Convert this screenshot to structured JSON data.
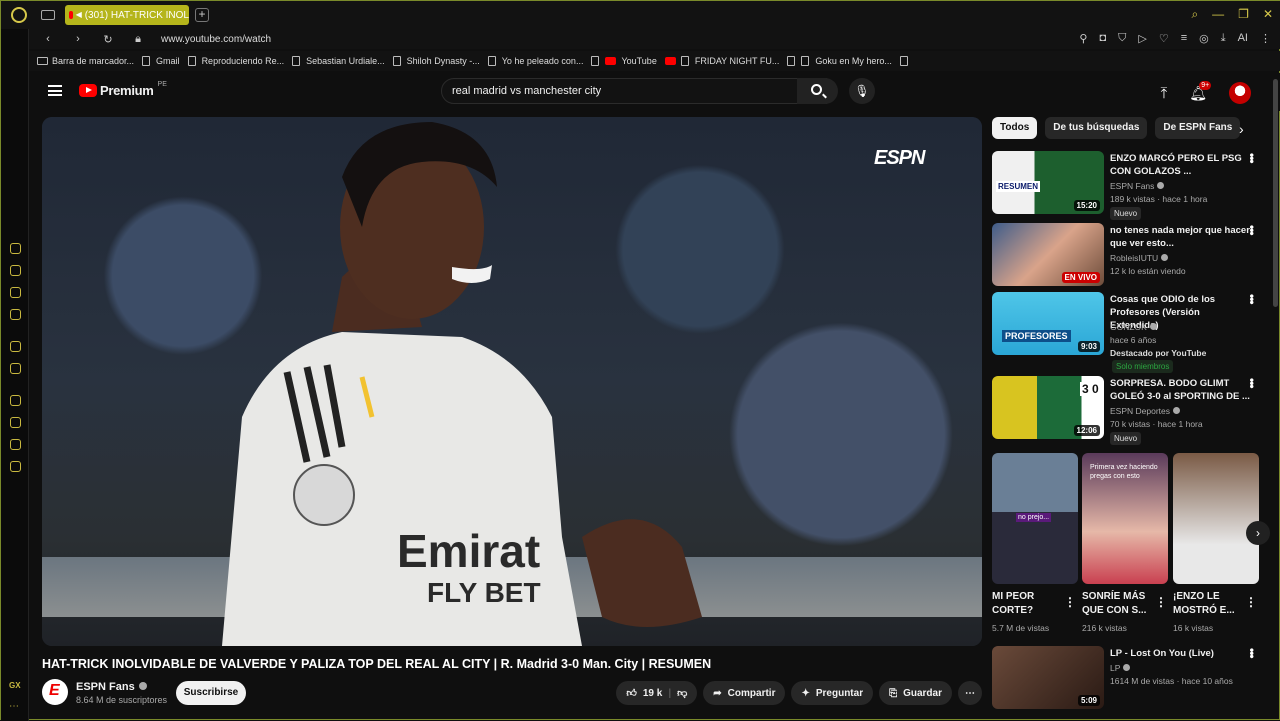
{
  "browser": {
    "tab_title": "(301) HAT-TRICK INOL",
    "url": "www.youtube.com/watch",
    "ai_label": "AI",
    "bookmarks": [
      "Barra de marcador...",
      "Gmail",
      "Reproduciendo Re...",
      "Sebastian Urdiale...",
      "Shiloh Dynasty -...",
      "Yo he peleado con...",
      "YouTube",
      "FRIDAY NIGHT FU...",
      "Goku en My hero..."
    ]
  },
  "header": {
    "brand": "Premium",
    "region": "PE",
    "search_value": "real madrid vs manchester city",
    "bell_badge": "9+"
  },
  "video": {
    "overlay_logo": "ESPN",
    "title": "HAT-TRICK INOLVIDABLE DE VALVERDE Y PALIZA TOP DEL REAL AL CITY | R. Madrid 3-0 Man. City | RESUMEN",
    "channel": "ESPN Fans",
    "subscribers": "8.64 M de suscriptores",
    "subscribe_label": "Suscribirse",
    "likes": "19 k",
    "share_label": "Compartir",
    "ask_label": "Preguntar",
    "save_label": "Guardar"
  },
  "chips": [
    "Todos",
    "De tus búsquedas",
    "De ESPN Fans"
  ],
  "recs": [
    {
      "title": "ENZO MARCÓ PERO EL PSG CON GOLAZOS ...",
      "channel": "ESPN Fans",
      "meta": "189 k vistas · hace 1 hora",
      "badge": "Nuevo",
      "duration": "15:20",
      "thumb_text": "RESUMEN"
    },
    {
      "title": "no tenes nada mejor que hacer que ver esto...",
      "channel": "RobleisIUTU",
      "meta": "12 k lo están viendo",
      "live": "EN VIVO"
    },
    {
      "title": "Cosas que ODIO de los Profesores (Versión Extendida)",
      "channel": "GONZOK",
      "meta": "hace 6 años",
      "featured": "Destacado por YouTube",
      "members": "Solo miembros",
      "duration": "9:03",
      "thumb_text": "PROFESORES"
    },
    {
      "title": "SORPRESA. BODO GLIMT GOLEÓ 3-0 al SPORTING DE ...",
      "channel": "ESPN Deportes",
      "meta": "70 k vistas · hace 1 hora",
      "badge": "Nuevo",
      "duration": "12:06",
      "thumb_text": "3 0"
    }
  ],
  "shorts": [
    {
      "title": "MI PEOR CORTE?",
      "views": "5.7 M de vistas",
      "caption": "no prejo..."
    },
    {
      "title": "SONRÍE MÁS QUE CON S...",
      "views": "216 k vistas",
      "caption": "Primera vez haciendo pregas con esto"
    },
    {
      "title": "¡ENZO LE MOSTRÓ E...",
      "views": "16 k vistas"
    }
  ],
  "lp": {
    "title": "LP - Lost On You (Live)",
    "channel": "LP",
    "meta": "1614 M de vistas · hace 10 años",
    "duration": "5:09"
  }
}
